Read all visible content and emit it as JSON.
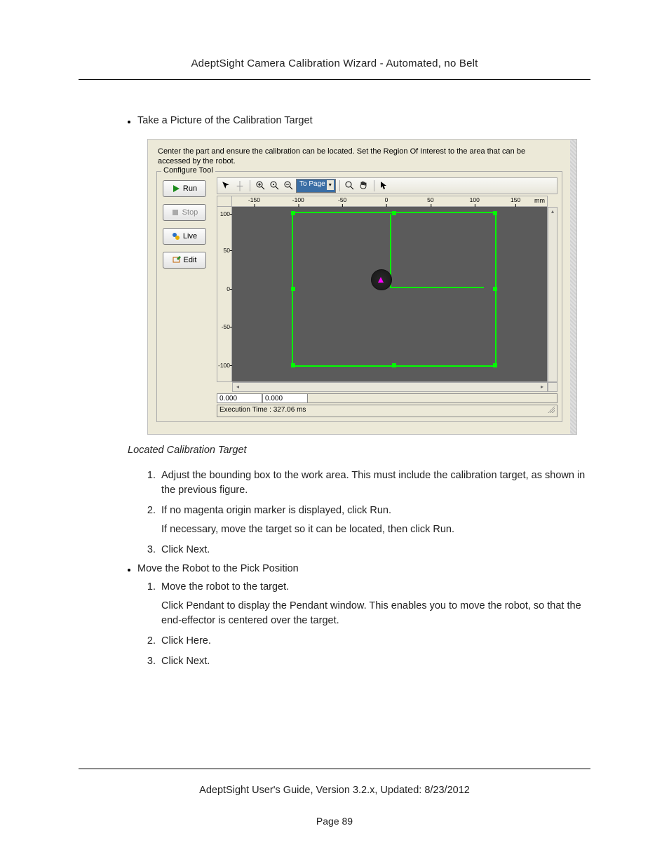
{
  "header": {
    "title": "AdeptSight Camera Calibration Wizard - Automated, no Belt"
  },
  "section_a": {
    "title": "Take a Picture of the Calibration Target"
  },
  "ui": {
    "instruction": "Center the part and ensure the calibration can be located. Set the Region Of Interest to the area that can be accessed by the robot.",
    "group_label": "Configure Tool",
    "buttons": {
      "run": "Run",
      "stop": "Stop",
      "live": "Live",
      "edit": "Edit"
    },
    "toolbar": {
      "dropdown": "To Page"
    },
    "ruler_x": [
      "-150",
      "-100",
      "-50",
      "0",
      "50",
      "100",
      "150"
    ],
    "ruler_x_unit": "mm",
    "ruler_y": [
      "100",
      "50",
      "0",
      "-50",
      "-100"
    ],
    "status": {
      "coord1": "0.000",
      "coord2": "0.000",
      "exec": "Execution Time : 327.06 ms"
    }
  },
  "caption": "Located Calibration Target",
  "steps_a": [
    "Adjust the bounding box to the work area. This must include the calibration target, as shown in the previous figure.",
    "If no magenta origin marker is displayed, click Run.",
    "Click Next."
  ],
  "steps_a_subnote": "If necessary, move the target so it can be located, then click Run.",
  "section_b": {
    "title": "Move the Robot to the Pick Position"
  },
  "steps_b": [
    "Move the robot to the target.",
    "Click Here.",
    "Click Next."
  ],
  "steps_b_subnote": "Click Pendant to display the Pendant window. This enables you to move the robot, so that the end-effector is centered over the target.",
  "footer": {
    "text": "AdeptSight User's Guide,  Version 3.2.x, Updated: 8/23/2012",
    "page": "Page 89"
  }
}
